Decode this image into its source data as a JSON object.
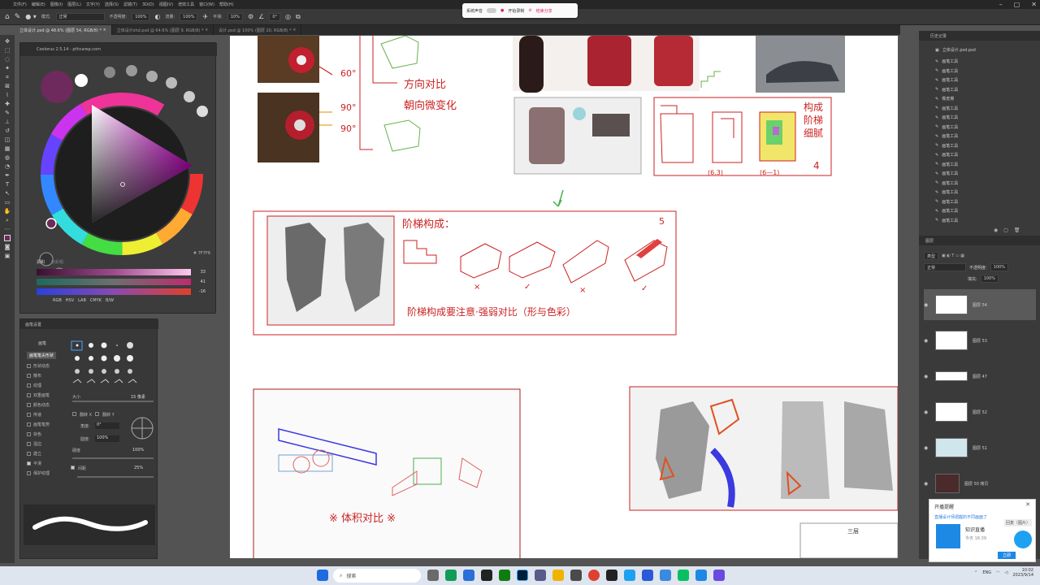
{
  "menu": [
    "文件(F)",
    "编辑(E)",
    "图像(I)",
    "图层(L)",
    "文字(Y)",
    "选择(S)",
    "滤镜(T)",
    "3D(D)",
    "视图(V)",
    "增效工具",
    "窗口(W)",
    "帮助(H)"
  ],
  "options": {
    "mode_label": "模式:",
    "mode_value": "正常",
    "opacity_label": "不透明度:",
    "opacity_value": "100%",
    "flow_label": "流量:",
    "flow_value": "100%",
    "smooth_label": "平滑:",
    "smooth_value": "10%",
    "angle_value": "0°"
  },
  "tabs": [
    {
      "label": "立体设计.psd @ 48.6% (图层 54, RGB/8) *",
      "active": true
    },
    {
      "label": "立体设计shd.psd @ 64.6% (图层 9, RGB/8) *",
      "active": false
    },
    {
      "label": "设计.psd @ 100% (图层 20, RGB/8) *",
      "active": false
    }
  ],
  "share_bar": {
    "sound_label": "系统声音",
    "record_label": "开始录制",
    "end_label": "结束分享"
  },
  "color_panel": {
    "title": "Coolorus 2.5.14 - pthcarep.com",
    "hex": "# 7F7F6",
    "tab_color": "调和",
    "tab_swatch": "色彩组",
    "sliders": [
      {
        "value": "33"
      },
      {
        "value": "41"
      },
      {
        "value": "-16"
      }
    ],
    "modes": [
      "RGB",
      "HSV",
      "LAB",
      "CMYK",
      "B/W"
    ],
    "primary_color": "#6e2a5c"
  },
  "brush_panel": {
    "title": "画笔设置",
    "preset_label": "画笔",
    "tip_label": "画笔笔尖形状",
    "options": [
      {
        "label": "形状动态",
        "on": false
      },
      {
        "label": "散布",
        "on": false
      },
      {
        "label": "纹理",
        "on": false
      },
      {
        "label": "双重画笔",
        "on": false
      },
      {
        "label": "颜色动态",
        "on": false
      },
      {
        "label": "传递",
        "on": false
      },
      {
        "label": "画笔笔势",
        "on": false
      },
      {
        "label": "杂色",
        "on": false
      },
      {
        "label": "湿边",
        "on": false
      },
      {
        "label": "建立",
        "on": false
      },
      {
        "label": "平滑",
        "on": true
      },
      {
        "label": "保护纹理",
        "on": false
      }
    ],
    "size_label": "大小",
    "size_value": "15 像素",
    "flip_x": "翻转 X",
    "flip_y": "翻转 Y",
    "angle_label": "角度:",
    "angle_value": "0°",
    "round_label": "圆度:",
    "round_value": "100%",
    "hardness_label": "硬度",
    "hardness_value": "100%",
    "spacing_label": "间距",
    "spacing_value": "25%"
  },
  "history": {
    "title": "历史记录",
    "doc": "立体设计.psd.psd",
    "items": [
      "画笔工具",
      "画笔工具",
      "画笔工具",
      "画笔工具",
      "橡皮擦",
      "画笔工具",
      "画笔工具",
      "画笔工具",
      "画笔工具",
      "画笔工具",
      "画笔工具",
      "画笔工具",
      "画笔工具",
      "画笔工具",
      "画笔工具",
      "画笔工具",
      "画笔工具",
      "画笔工具"
    ]
  },
  "layers": {
    "title": "图层",
    "kind": "类型",
    "blend": "正常",
    "opacity_label": "不透明度:",
    "opacity_value": "100%",
    "fill_label": "填充:",
    "fill_value": "100%",
    "items": [
      {
        "name": "图层 54"
      },
      {
        "name": "图层 53"
      },
      {
        "name": "图层 47"
      },
      {
        "name": "图层 52"
      },
      {
        "name": "图层 51"
      },
      {
        "name": "图层 50 拷贝"
      }
    ]
  },
  "canvas": {
    "n1_a": "60°",
    "n1_b": "90°",
    "n1_c": "90°",
    "n2_a": "方向对比",
    "n2_b": "朝向微变化",
    "n3_a": "构成",
    "n3_b": "阶梯",
    "n3_c": "细腻",
    "n3_d": "(6.3)",
    "n3_e": "(6—1)",
    "n3_num": "4",
    "stair_title": "阶梯构成：",
    "stair_num": "5",
    "stair_note": "阶梯构成要注意·强弱对比（形与色彩）",
    "marks": [
      "×",
      "✓",
      "×",
      "✓"
    ],
    "vol_title": "※ 体积对比 ※",
    "small_note": "三层"
  },
  "notification": {
    "title": "开播提醒",
    "line1": "直播设计师把握的不同画面了",
    "sender": "知识直播",
    "time": "今天 18:39",
    "reply": "回复（图片）",
    "action": "立即"
  },
  "taskbar": {
    "search": "搜索",
    "lang": "ENG",
    "time": "10:02",
    "date": "2023/9/14"
  }
}
